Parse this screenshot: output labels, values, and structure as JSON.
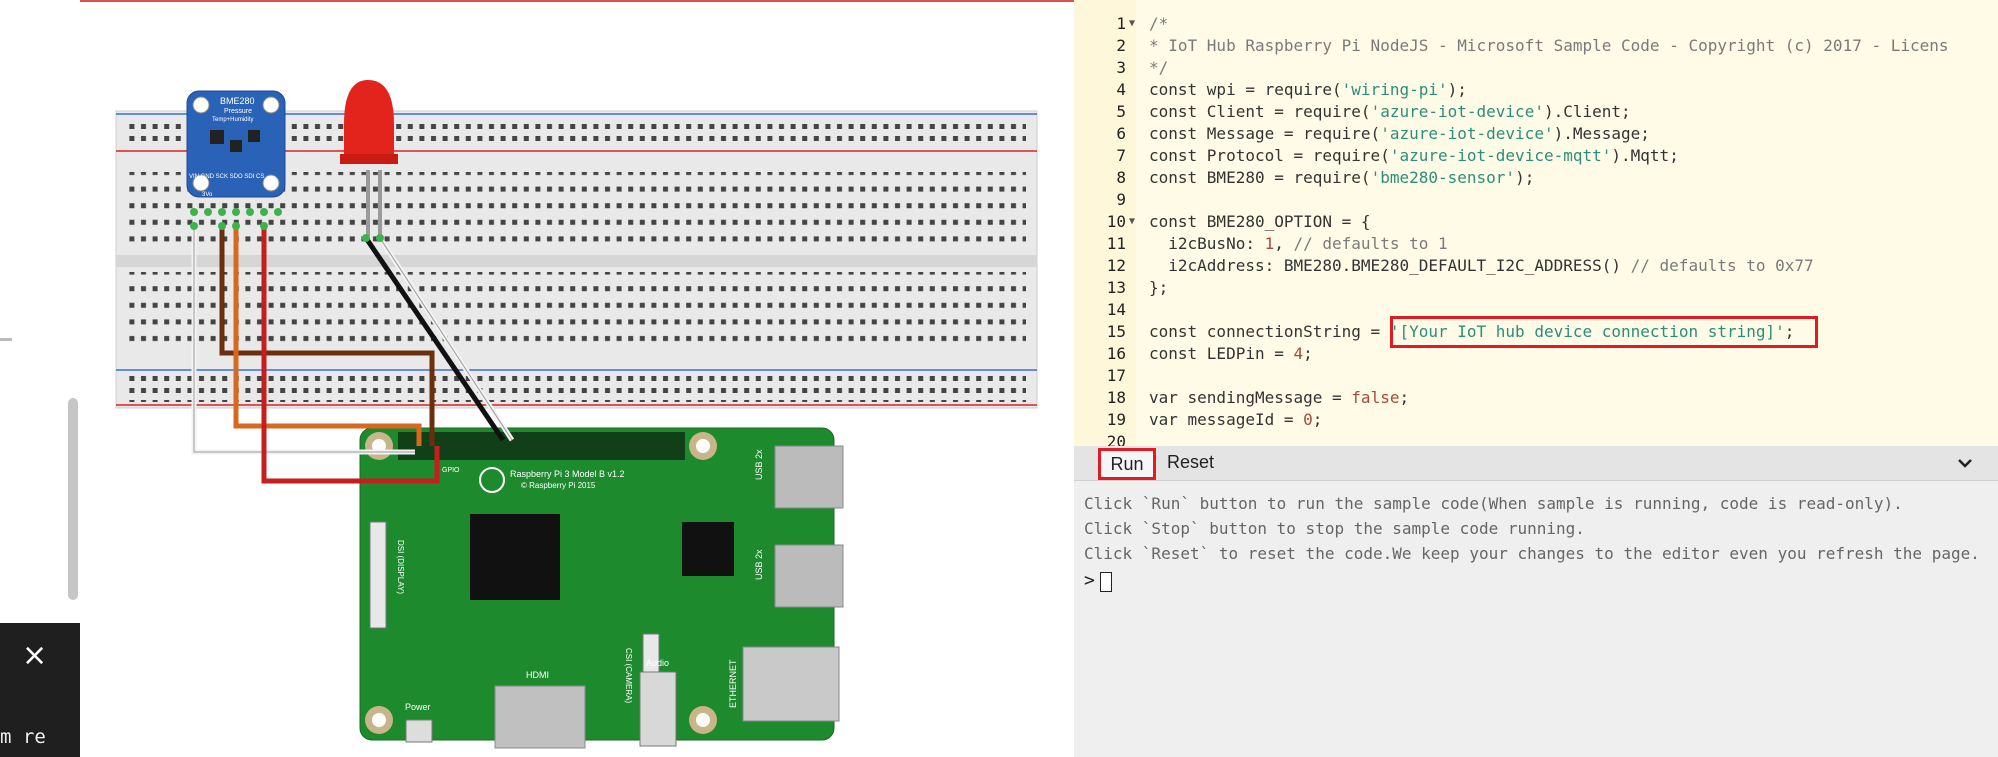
{
  "toast": {
    "close_glyph": "×",
    "text": "m re"
  },
  "circuit": {
    "sensor": {
      "name": "BME280",
      "subtitle1": "Pressure",
      "subtitle2": "Temp+Humidity",
      "pins": "VIN  GND  SCK  SDO  SDI  CS",
      "pins2": "3Vo"
    },
    "board": {
      "model": "Raspberry Pi 3 Model B v1.2",
      "copyright": "© Raspberry Pi 2015",
      "usb1": "USB 2x",
      "usb2": "USB 2x",
      "ethernet": "ETHERNET",
      "hdmi": "HDMI",
      "audio": "Audio",
      "power": "Power",
      "dsi": "DSI (DISPLAY)",
      "csi": "CSI (CAMERA)",
      "gpio": "GPIO"
    },
    "colors": {
      "board": "#1e8a2e",
      "breadboard": "#e6e6e6",
      "led": "#e3241d",
      "sensor": "#2a62b8"
    }
  },
  "editor": {
    "lines": [
      {
        "n": "1",
        "fold": true,
        "parts": [
          [
            "cm",
            "/*"
          ]
        ]
      },
      {
        "n": "2",
        "parts": [
          [
            "cm",
            "* IoT Hub Raspberry Pi NodeJS - Microsoft Sample Code - Copyright (c) 2017 - Licens"
          ]
        ]
      },
      {
        "n": "3",
        "parts": [
          [
            "cm",
            "*/"
          ]
        ]
      },
      {
        "n": "4",
        "parts": [
          [
            "kw",
            "const wpi = require("
          ],
          [
            "str",
            "'wiring-pi'"
          ],
          [
            "kw",
            ");"
          ]
        ]
      },
      {
        "n": "5",
        "parts": [
          [
            "kw",
            "const Client = require("
          ],
          [
            "str",
            "'azure-iot-device'"
          ],
          [
            "kw",
            ").Client;"
          ]
        ]
      },
      {
        "n": "6",
        "parts": [
          [
            "kw",
            "const Message = require("
          ],
          [
            "str",
            "'azure-iot-device'"
          ],
          [
            "kw",
            ").Message;"
          ]
        ]
      },
      {
        "n": "7",
        "parts": [
          [
            "kw",
            "const Protocol = require("
          ],
          [
            "str",
            "'azure-iot-device-mqtt'"
          ],
          [
            "kw",
            ").Mqtt;"
          ]
        ]
      },
      {
        "n": "8",
        "parts": [
          [
            "kw",
            "const BME280 = require("
          ],
          [
            "str",
            "'bme280-sensor'"
          ],
          [
            "kw",
            ");"
          ]
        ]
      },
      {
        "n": "9",
        "parts": []
      },
      {
        "n": "10",
        "fold": true,
        "parts": [
          [
            "kw",
            "const BME280_OPTION = {"
          ]
        ]
      },
      {
        "n": "11",
        "parts": [
          [
            "kw",
            "  i2cBusNo: "
          ],
          [
            "num",
            "1"
          ],
          [
            "kw",
            ", "
          ],
          [
            "cm",
            "// defaults to 1"
          ]
        ]
      },
      {
        "n": "12",
        "parts": [
          [
            "kw",
            "  i2cAddress: BME280.BME280_DEFAULT_I2C_ADDRESS() "
          ],
          [
            "cm",
            "// defaults to 0x77"
          ]
        ]
      },
      {
        "n": "13",
        "parts": [
          [
            "kw",
            "};"
          ]
        ]
      },
      {
        "n": "14",
        "parts": []
      },
      {
        "n": "15",
        "parts": [
          [
            "kw",
            "const connectionString = "
          ],
          [
            "str",
            "'[Your IoT hub device connection string]'"
          ],
          [
            "kw",
            ";"
          ]
        ]
      },
      {
        "n": "16",
        "parts": [
          [
            "kw",
            "const LEDPin = "
          ],
          [
            "num",
            "4"
          ],
          [
            "kw",
            ";"
          ]
        ]
      },
      {
        "n": "17",
        "parts": []
      },
      {
        "n": "18",
        "parts": [
          [
            "kw",
            "var sendingMessage = "
          ],
          [
            "num",
            "false"
          ],
          [
            "kw",
            ";"
          ]
        ]
      },
      {
        "n": "19",
        "parts": [
          [
            "kw",
            "var messageId = "
          ],
          [
            "num",
            "0"
          ],
          [
            "kw",
            ";"
          ]
        ]
      },
      {
        "n": "20",
        "parts": []
      }
    ]
  },
  "console": {
    "run_label": "Run",
    "reset_label": "Reset",
    "output": [
      "Click `Run` button to run the sample code(When sample is running, code is read-only).",
      "Click `Stop` button to stop the sample code running.",
      "Click `Reset` to reset the code.We keep your changes to the editor even you refresh the page."
    ],
    "prompt": ">"
  }
}
